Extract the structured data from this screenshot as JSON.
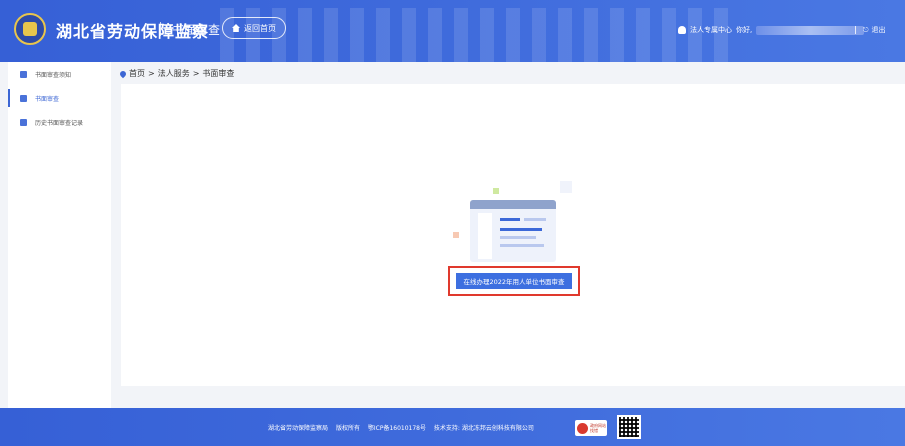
{
  "header": {
    "site_title": "湖北省劳动保障监察",
    "section_title": "书面审查",
    "home_button_label": "返回首页",
    "user_center_label": "法人专属中心",
    "greeting": "你好,",
    "logout_label": "退出"
  },
  "sidebar": {
    "items": [
      {
        "label": "书面审查须知",
        "icon": "document-icon"
      },
      {
        "label": "书面审查",
        "icon": "upload-icon",
        "active": true
      },
      {
        "label": "历史书面审查记录",
        "icon": "file-icon"
      }
    ]
  },
  "breadcrumb": {
    "items": [
      "首页",
      "法人服务",
      "书面审查"
    ],
    "separator": ">"
  },
  "main": {
    "action_button_label": "在线办理2022年用人单位书面审查"
  },
  "footer": {
    "org": "湖北省劳动保障监察局",
    "rights": "版权所有",
    "icp": "鄂ICP备16010178号",
    "support": "技术支持: 湖北冻邦云创科技有限公司",
    "badge_line1": "政府网站",
    "badge_line2": "找错"
  },
  "colors": {
    "brand_blue": "#3d6fe0",
    "highlight_red": "#e0392d"
  }
}
